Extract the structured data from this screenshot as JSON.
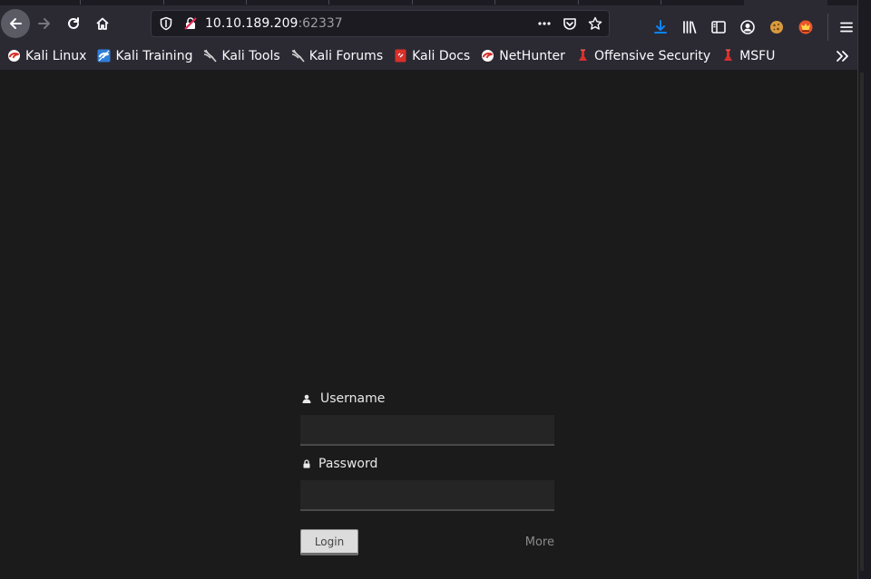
{
  "browser": {
    "url_host": "10.10.189.209",
    "url_port": ":62337"
  },
  "bookmarks": [
    {
      "label": "Kali Linux",
      "icon": "kali-dragon-icon"
    },
    {
      "label": "Kali Training",
      "icon": "kali-training-icon"
    },
    {
      "label": "Kali Tools",
      "icon": "kali-tools-icon"
    },
    {
      "label": "Kali Forums",
      "icon": "kali-forums-icon"
    },
    {
      "label": "Kali Docs",
      "icon": "kali-docs-icon"
    },
    {
      "label": "NetHunter",
      "icon": "nethunter-icon"
    },
    {
      "label": "Offensive Security",
      "icon": "offsec-icon"
    },
    {
      "label": "MSFU",
      "icon": "msfu-icon"
    }
  ],
  "login": {
    "username_label": "Username",
    "password_label": "Password",
    "username_value": "",
    "password_value": "",
    "login_button": "Login",
    "more_link": "More"
  },
  "colors": {
    "page_bg": "#1b1b1b",
    "chrome_bg": "#2b2a33",
    "download_accent": "#0a84ff"
  }
}
